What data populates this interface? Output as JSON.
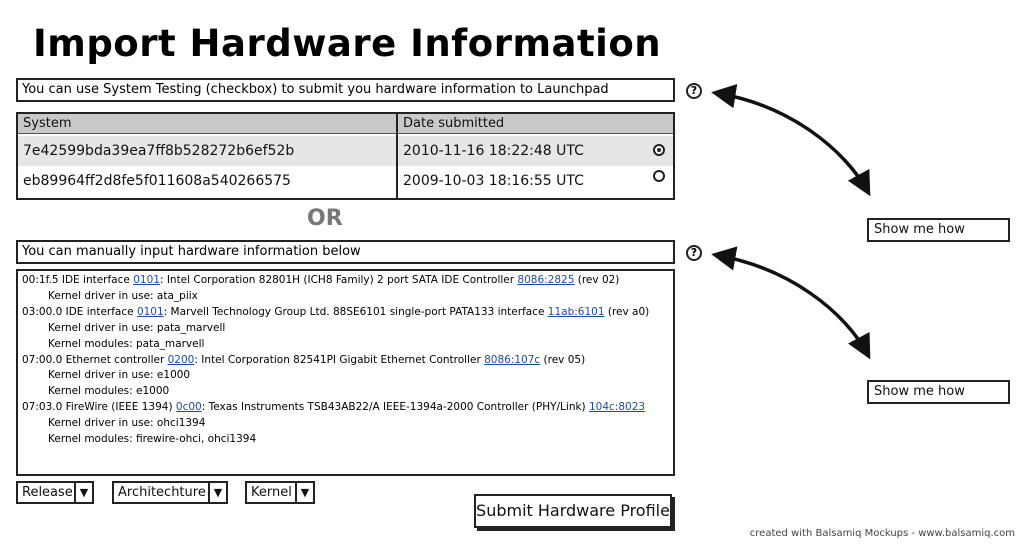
{
  "title": "Import Hardware Information",
  "auto_section": {
    "info": "You can use System Testing (checkbox) to submit you hardware information to Launchpad",
    "columns": [
      "System",
      "Date submitted"
    ],
    "rows": [
      {
        "system": "7e42599bda39ea7ff8b528272b6ef52b",
        "date": "2010-11-16 18:22:48 UTC",
        "selected": true
      },
      {
        "system": "eb89964ff2d8fe5f011608a540266575",
        "date": "2009-10-03 18:16:55 UTC",
        "selected": false
      }
    ]
  },
  "or_label": "OR",
  "manual_section": {
    "info": "You can manually input hardware information below",
    "lines": [
      {
        "pre": "00:1f.5 IDE interface ",
        "l1": "0101",
        "mid": ": Intel Corporation 82801H (ICH8 Family) 2 port SATA IDE Controller ",
        "l2": "8086:2825",
        "post": " (rev 02)"
      },
      {
        "text": "Kernel driver in use: ata_piix"
      },
      {
        "pre": "03:00.0 IDE interface ",
        "l1": "0101",
        "mid": ": Marvell Technology Group Ltd. 88SE6101 single-port PATA133 interface ",
        "l2": "11ab:6101",
        "post": " (rev a0)"
      },
      {
        "text": "Kernel driver in use: pata_marvell"
      },
      {
        "text": "Kernel modules: pata_marvell"
      },
      {
        "pre": "07:00.0 Ethernet controller ",
        "l1": "0200",
        "mid": ": Intel Corporation 82541PI Gigabit Ethernet Controller ",
        "l2": "8086:107c",
        "post": " (rev 05)"
      },
      {
        "text": "Kernel driver in use: e1000"
      },
      {
        "text": "Kernel modules: e1000"
      },
      {
        "pre": "07:03.0 FireWire (IEEE 1394) ",
        "l1": "0c00",
        "mid": ": Texas Instruments TSB43AB22/A IEEE-1394a-2000 Controller (PHY/Link) ",
        "l2": "104c:8023",
        "post": ""
      },
      {
        "text": "Kernel driver in use: ohci1394"
      },
      {
        "text": "Kernel modules: firewire-ohci, ohci1394"
      }
    ]
  },
  "dropdowns": {
    "release": "Release",
    "architecture": "Architechture",
    "kernel": "Kernel",
    "arrow": "▼"
  },
  "submit_label": "Submit Hardware Profile",
  "help_icon_glyph": "?",
  "show_me_how_1": "Show me how",
  "show_me_how_2": "Show me how",
  "credit": "created with Balsamiq Mockups - www.balsamiq.com"
}
